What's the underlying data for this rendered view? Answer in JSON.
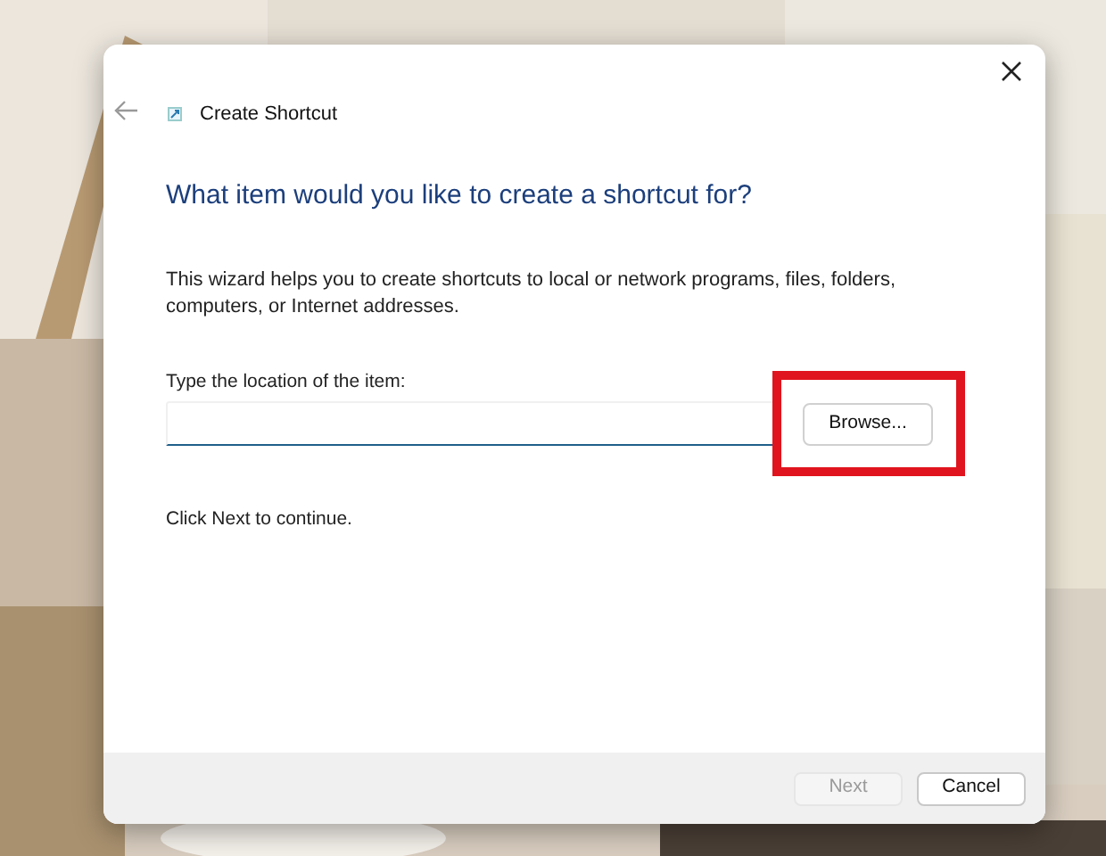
{
  "window": {
    "title": "Create Shortcut"
  },
  "heading": "What item would you like to create a shortcut for?",
  "description": "This wizard helps you to create shortcuts to local or network programs, files, folders, computers, or Internet addresses.",
  "location_field": {
    "label": "Type the location of the item:",
    "focused": true
  },
  "browse_button": {
    "label": "Browse...",
    "highlighted": true
  },
  "hint": "Click Next to continue.",
  "buttons": [
    {
      "label": "Next",
      "disabled": true
    },
    {
      "label": "Cancel",
      "disabled": false
    }
  ]
}
